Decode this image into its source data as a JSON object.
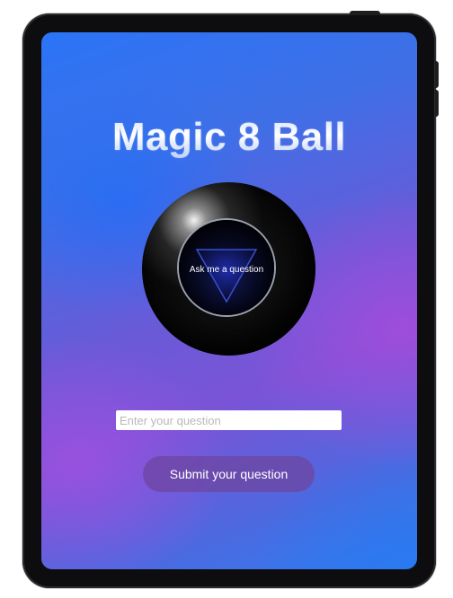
{
  "app": {
    "title": "Magic 8 Ball"
  },
  "ball": {
    "answer_text": "Ask me a question"
  },
  "form": {
    "question_placeholder": "Enter your question",
    "question_value": "",
    "submit_label": "Submit your question"
  },
  "colors": {
    "gradient_blue": "#2b74f7",
    "gradient_purple": "#a34fd8",
    "button_bg": "#6e46a0",
    "triangle_stroke": "#3a4fd0"
  },
  "icons": {
    "ball": "magic-8-ball-icon",
    "triangle": "answer-triangle-icon"
  }
}
